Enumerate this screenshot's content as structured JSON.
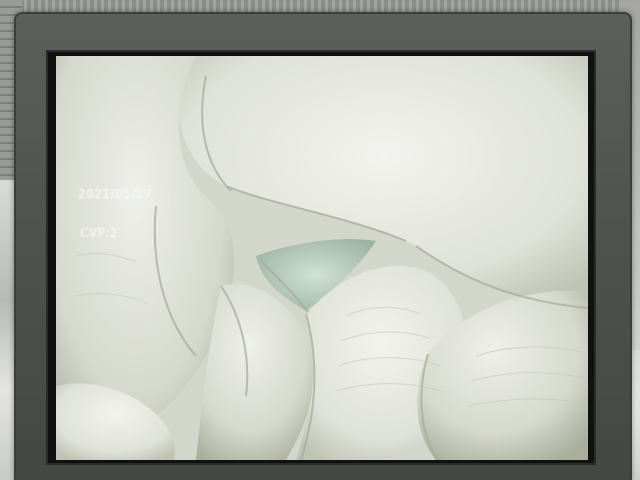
{
  "screen_overlay": {
    "date": "2021/05/27",
    "cvp": "CVP:2"
  },
  "colors": {
    "tissue_light": "#eceee6",
    "tissue_mid": "#cfd3c6",
    "tissue_shadow": "#9ea392",
    "lumen": "#c6d8cb",
    "bezel": "#4f514f"
  }
}
